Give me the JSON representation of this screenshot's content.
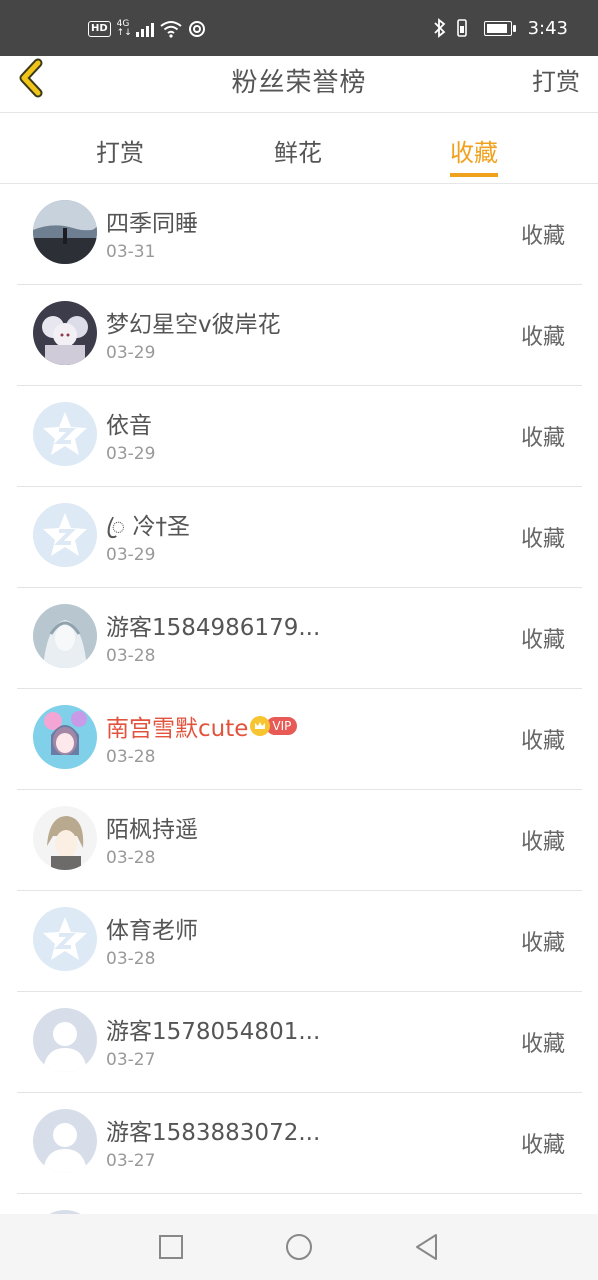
{
  "status_bar": {
    "hd": "HD",
    "network": "4G",
    "network_sub": "↑↓",
    "time": "3:43",
    "icons": [
      "hd-icon",
      "signal-icon",
      "wifi-icon",
      "data-saver-icon",
      "bluetooth-icon",
      "vibrate-icon",
      "battery-icon"
    ],
    "battery_level": 0.8
  },
  "header": {
    "title": "粉丝荣誉榜",
    "action": "打赏",
    "back_icon": "chevron-left-icon",
    "back_color": "#f0c419"
  },
  "tabs": [
    {
      "label": "打赏",
      "active": false
    },
    {
      "label": "鲜花",
      "active": false
    },
    {
      "label": "收藏",
      "active": true
    }
  ],
  "accent_color": "#f0a21f",
  "list": [
    {
      "name": "四季同睡",
      "date": "03-31",
      "action": "收藏",
      "avatar": "photo-avatar"
    },
    {
      "name": "梦幻星空v彼岸花",
      "date": "03-29",
      "action": "收藏",
      "avatar": "anime-group-avatar"
    },
    {
      "name": "依音",
      "date": "03-29",
      "action": "收藏",
      "avatar": "default-star-avatar"
    },
    {
      "name": "ꦿ 冷†圣",
      "date": "03-29",
      "action": "收藏",
      "avatar": "default-star-avatar"
    },
    {
      "name": "游客1584986179...",
      "date": "03-28",
      "action": "收藏",
      "avatar": "anime-avatar"
    },
    {
      "name": "南宫雪默cute",
      "date": "03-28",
      "action": "收藏",
      "avatar": "anime-avatar",
      "vip": "VIP"
    },
    {
      "name": "陌枫持遥",
      "date": "03-28",
      "action": "收藏",
      "avatar": "anime-avatar"
    },
    {
      "name": "体育老师",
      "date": "03-28",
      "action": "收藏",
      "avatar": "default-star-avatar"
    },
    {
      "name": "游客1578054801...",
      "date": "03-27",
      "action": "收藏",
      "avatar": "default-person-avatar"
    },
    {
      "name": "游客1583883072...",
      "date": "03-27",
      "action": "收藏",
      "avatar": "default-person-avatar"
    }
  ],
  "nav_bar": {
    "icons": [
      "square-recent-icon",
      "circle-home-icon",
      "triangle-back-icon"
    ]
  }
}
